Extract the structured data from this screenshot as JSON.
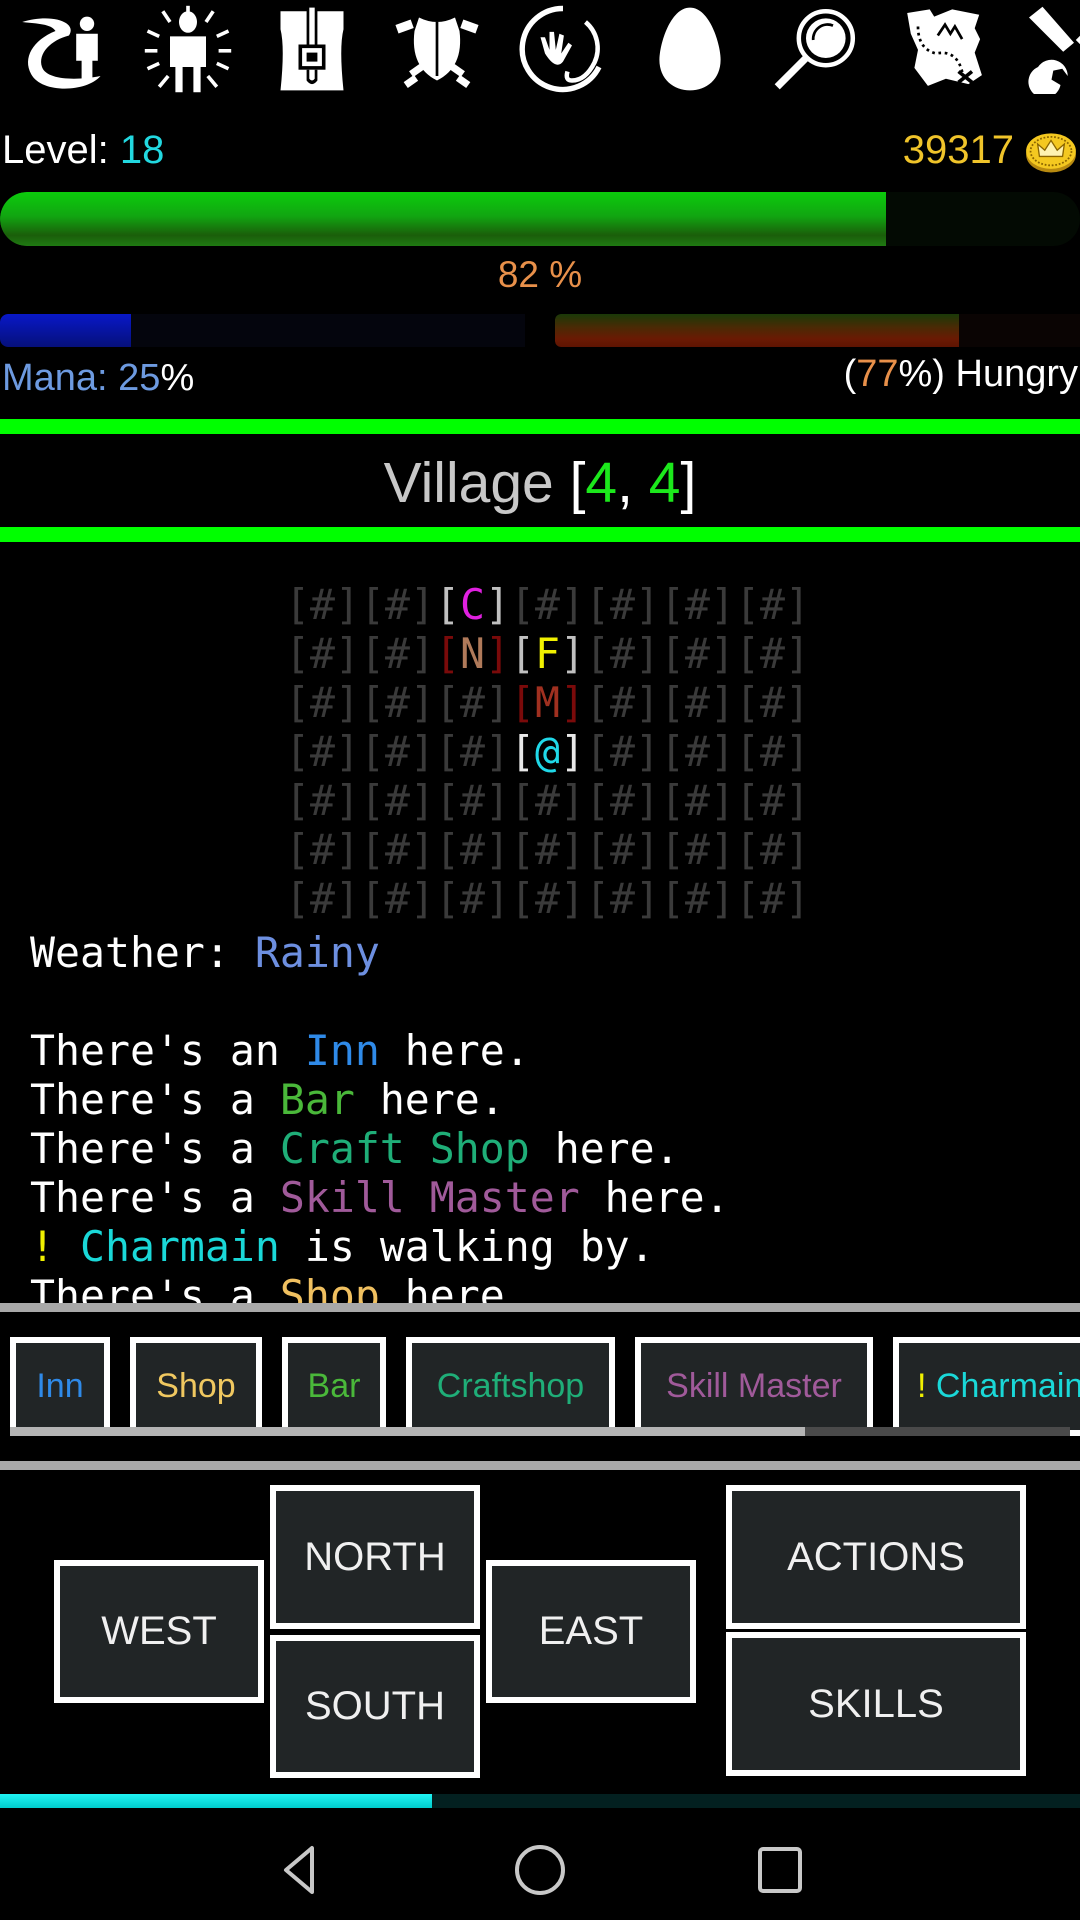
{
  "toolbar": {
    "icons": [
      {
        "name": "travel-icon"
      },
      {
        "name": "character-aura-icon"
      },
      {
        "name": "backpack-icon"
      },
      {
        "name": "armor-icon"
      },
      {
        "name": "magic-hand-icon"
      },
      {
        "name": "egg-icon"
      },
      {
        "name": "magnifier-icon"
      },
      {
        "name": "treasure-map-icon"
      },
      {
        "name": "tools-icon"
      }
    ]
  },
  "stats": {
    "level_label": "Level: ",
    "level_value": "18",
    "gold": "39317",
    "gold_icon": "crown-coin-icon",
    "health_percent": 82,
    "health_text": "82 %",
    "mana_label": "Mana: ",
    "mana_value": "25",
    "mana_suffix": "%",
    "mana_percent": 25,
    "hunger_open": "(",
    "hunger_value": "77",
    "hunger_close": "%) ",
    "hunger_status": "Hungry",
    "hunger_percent": 77,
    "xp_percent": 40
  },
  "location": {
    "name": "Village ",
    "open": "[",
    "x": "4",
    "sep": ", ",
    "y": "4",
    "close": "]"
  },
  "map": {
    "rows": [
      [
        {
          "c": "#"
        },
        {
          "c": "#"
        },
        {
          "c": "C",
          "color": "#e020e0",
          "bracket": "#c0c0c0"
        },
        {
          "c": "#"
        },
        {
          "c": "#"
        },
        {
          "c": "#"
        },
        {
          "c": "#"
        }
      ],
      [
        {
          "c": "#"
        },
        {
          "c": "#"
        },
        {
          "c": "N",
          "color": "#b07a5a",
          "bracket": "#7a0a0a"
        },
        {
          "c": "F",
          "color": "#f0f000",
          "bracket": "#c0c0c0"
        },
        {
          "c": "#"
        },
        {
          "c": "#"
        },
        {
          "c": "#"
        }
      ],
      [
        {
          "c": "#"
        },
        {
          "c": "#"
        },
        {
          "c": "#"
        },
        {
          "c": "M",
          "color": "#a03020",
          "bracket": "#7a0a0a"
        },
        {
          "c": "#"
        },
        {
          "c": "#"
        },
        {
          "c": "#"
        }
      ],
      [
        {
          "c": "#"
        },
        {
          "c": "#"
        },
        {
          "c": "#"
        },
        {
          "c": "@",
          "color": "#20d8e8",
          "bracket": "#e8e8e8"
        },
        {
          "c": "#"
        },
        {
          "c": "#"
        },
        {
          "c": "#"
        }
      ],
      [
        {
          "c": "#"
        },
        {
          "c": "#"
        },
        {
          "c": "#"
        },
        {
          "c": "#"
        },
        {
          "c": "#"
        },
        {
          "c": "#"
        },
        {
          "c": "#"
        }
      ],
      [
        {
          "c": "#"
        },
        {
          "c": "#"
        },
        {
          "c": "#"
        },
        {
          "c": "#"
        },
        {
          "c": "#"
        },
        {
          "c": "#"
        },
        {
          "c": "#"
        }
      ],
      [
        {
          "c": "#"
        },
        {
          "c": "#"
        },
        {
          "c": "#"
        },
        {
          "c": "#"
        },
        {
          "c": "#"
        },
        {
          "c": "#"
        },
        {
          "c": "#"
        }
      ]
    ]
  },
  "log": [
    [
      {
        "t": "Weather: ",
        "color": "#ffffff"
      },
      {
        "t": "Rainy",
        "color": "#6d8fe0"
      }
    ],
    [],
    [
      {
        "t": "There's an ",
        "color": "#ffffff"
      },
      {
        "t": "Inn",
        "color": "#2f8ae8"
      },
      {
        "t": " here.",
        "color": "#ffffff"
      }
    ],
    [
      {
        "t": "There's a ",
        "color": "#ffffff"
      },
      {
        "t": "Bar",
        "color": "#4ab83a"
      },
      {
        "t": " here.",
        "color": "#ffffff"
      }
    ],
    [
      {
        "t": "There's a ",
        "color": "#ffffff"
      },
      {
        "t": "Craft Shop",
        "color": "#1fae78"
      },
      {
        "t": " here.",
        "color": "#ffffff"
      }
    ],
    [
      {
        "t": "There's a ",
        "color": "#ffffff"
      },
      {
        "t": "Skill Master",
        "color": "#a05a9a"
      },
      {
        "t": " here.",
        "color": "#ffffff"
      }
    ],
    [
      {
        "t": "! ",
        "color": "#f0f000"
      },
      {
        "t": "Charmain",
        "color": "#1ad8d8"
      },
      {
        "t": " is walking by.",
        "color": "#ffffff"
      }
    ],
    [
      {
        "t": "There's a ",
        "color": "#ffffff"
      },
      {
        "t": "Shop",
        "color": "#f0c060"
      },
      {
        "t": " here.",
        "color": "#ffffff"
      }
    ]
  ],
  "quick_actions": [
    {
      "label": "Inn",
      "color": "#2f8ae8"
    },
    {
      "label": "Shop",
      "color": "#f0c860"
    },
    {
      "label": "Bar",
      "color": "#4ab83a"
    },
    {
      "label": "Craftshop",
      "color": "#1fae78"
    },
    {
      "label": "Skill Master",
      "color": "#a05a9a"
    },
    {
      "prefix": "! ",
      "prefix_color": "#f0f000",
      "label": "Charmain",
      "color": "#1ad8d8"
    }
  ],
  "quick_scroll_fraction": 0.75,
  "controls": {
    "north": "NORTH",
    "south": "SOUTH",
    "west": "WEST",
    "east": "EAST",
    "actions": "ACTIONS",
    "skills": "SKILLS"
  },
  "system_nav": {
    "back": "back-icon",
    "home": "home-icon",
    "recents": "recents-icon"
  }
}
